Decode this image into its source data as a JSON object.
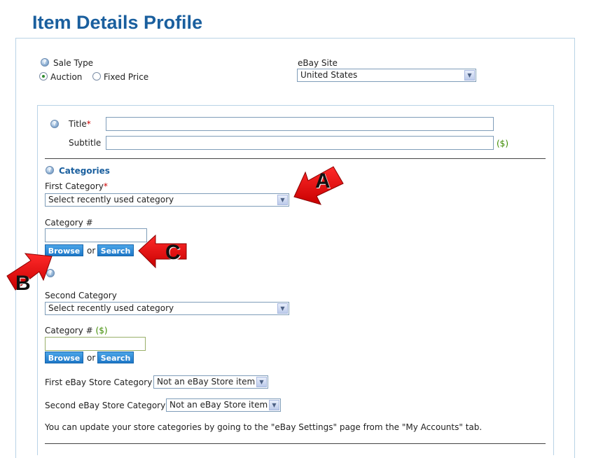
{
  "page": {
    "title": "Item Details Profile"
  },
  "sale_type": {
    "label": "Sale Type",
    "options": [
      {
        "label": "Auction",
        "selected": true
      },
      {
        "label": "Fixed Price",
        "selected": false
      }
    ]
  },
  "ebay_site": {
    "label": "eBay Site",
    "value": "United States"
  },
  "title_field": {
    "label": "Title",
    "required_mark": "*",
    "value": ""
  },
  "subtitle_field": {
    "label": "Subtitle",
    "value": "",
    "fee_note": "($)"
  },
  "categories": {
    "heading": "Categories",
    "first": {
      "label": "First Category",
      "required_mark": "*",
      "select_value": "Select recently used category",
      "number_label": "Category #",
      "number_value": "",
      "browse_label": "Browse",
      "or_label": "or",
      "search_label": "Search"
    },
    "second": {
      "label": "Second Category",
      "select_value": "Select recently used category",
      "number_label": "Category #",
      "number_fee": "($)",
      "number_value": "",
      "browse_label": "Browse",
      "or_label": "or",
      "search_label": "Search"
    }
  },
  "store": {
    "first_label": "First eBay Store Category",
    "first_value": "Not an eBay Store item",
    "second_label": "Second eBay Store Category",
    "second_value": "Not an eBay Store item",
    "note": "You can update your store categories by going to the \"eBay Settings\" page from the \"My Accounts\" tab."
  },
  "callouts": {
    "a": "A",
    "b": "B",
    "c": "C"
  },
  "colors": {
    "title_blue": "#1a5f9e",
    "button_blue": "#1e78c8",
    "arrow_red": "#e8141a",
    "panel_border": "#b9d3e6"
  }
}
